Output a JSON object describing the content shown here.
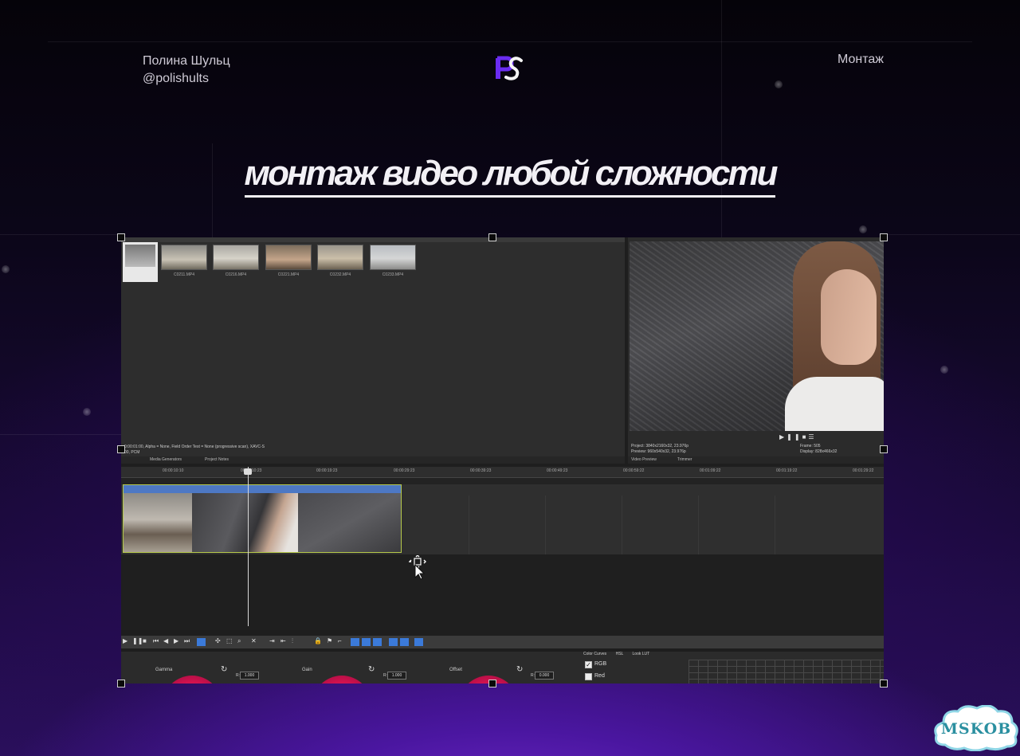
{
  "header": {
    "author_name": "Полина Шульц",
    "author_handle": "@polishults",
    "logo_text": "PS",
    "section": "Монтаж"
  },
  "headline": "монтаж видео любой сложности",
  "editor": {
    "media_clips": [
      "C0211.MP4",
      "C0216.MP4",
      "C0221.MP4",
      "C0232.MP4",
      "C0233.MP4"
    ],
    "media_info_line1": "0:00:01:00, Alpha = None, Field Order Test = None (progressive scan), XAVC-S",
    "media_info_line2": "00, PCM",
    "bottom_tabs": [
      "Media Generators",
      "Project Notes"
    ],
    "preview_info": {
      "project": "Project:  3840x2160x32, 23.976p",
      "preview": "Preview:  960x540x32, 23.976p",
      "frame": "Frame:    505",
      "display": "Display:  828x466x32"
    },
    "preview_tabs": [
      "Video Preview",
      "Trimmer"
    ],
    "timeline_ruler": [
      "00:00:10:10",
      "00:00:10:23",
      "00:00:19:23",
      "00:00:29:23",
      "00:00:39:23",
      "00:00:49:23",
      "00:00:59:22",
      "00:01:09:22",
      "00:01:19:22",
      "00:01:29:22"
    ],
    "color_panel": {
      "gamma_label": "Gamma",
      "gain_label": "Gain",
      "offset_label": "Offset",
      "field_letter": "R:",
      "gamma_value": "1.000",
      "gain_value": "1.000",
      "offset_value": "0.000",
      "tabs": [
        "Color Curves",
        "HSL",
        "Look LUT"
      ],
      "check_rgb": "RGB",
      "check_red": "Red"
    }
  },
  "watermark": "MSKOB",
  "colors": {
    "accent_purple": "#7a2dd6",
    "clip_header_blue": "#4d78c4",
    "clip_border": "#b6c94a"
  }
}
